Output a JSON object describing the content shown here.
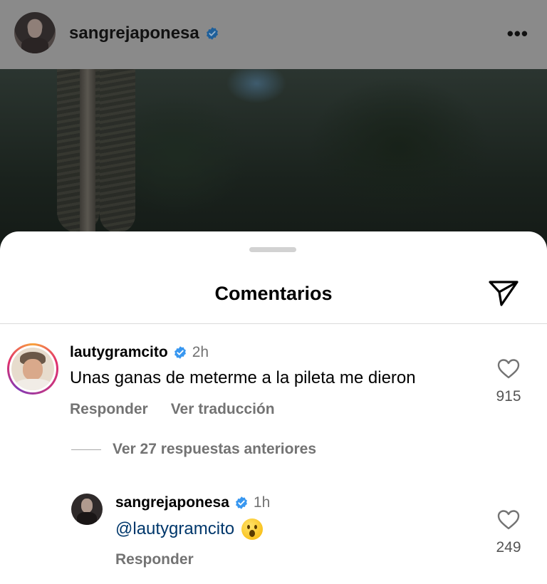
{
  "post": {
    "username": "sangrejaponesa",
    "more_icon": "more-horizontal-icon"
  },
  "sheet": {
    "title": "Comentarios",
    "share_icon": "send-icon"
  },
  "comment": {
    "username": "lautygramcito",
    "time": "2h",
    "text": "Unas ganas de meterme a la pileta me dieron",
    "reply_label": "Responder",
    "translate_label": "Ver traducción",
    "likes": "915",
    "view_replies_label": "Ver 27 respuestas anteriores"
  },
  "reply": {
    "username": "sangrejaponesa",
    "time": "1h",
    "mention": "@lautygramcito",
    "emoji": "😮",
    "reply_label": "Responder",
    "likes": "249"
  },
  "colors": {
    "verified_blue": "#3897f0",
    "mention_blue": "#00376b",
    "secondary_text": "#737373"
  }
}
